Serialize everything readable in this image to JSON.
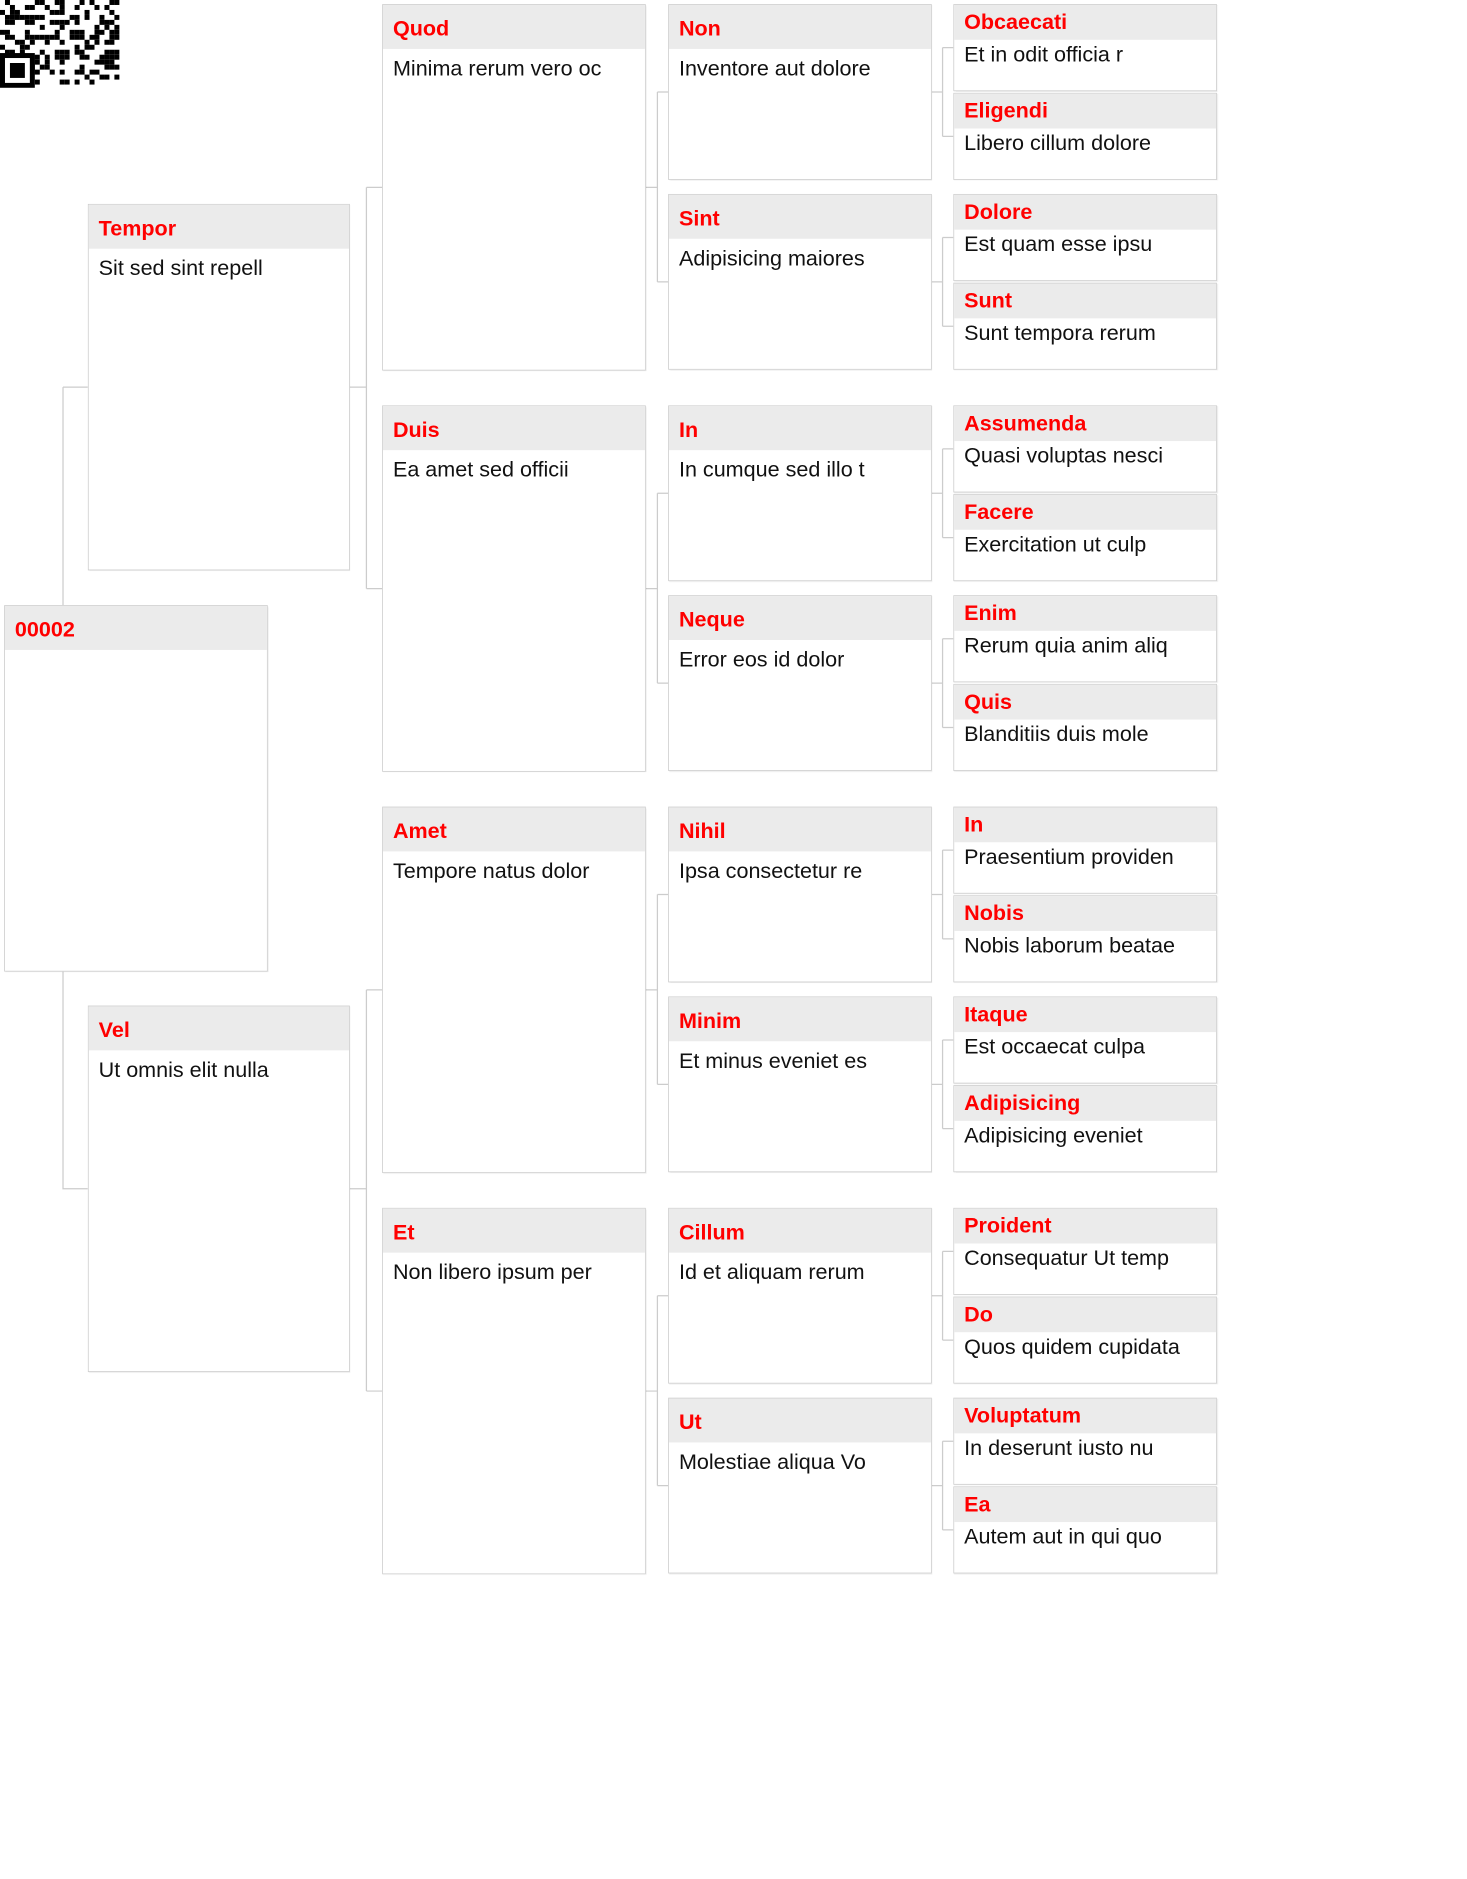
{
  "diagram": {
    "root": {
      "title": "00002",
      "body": ""
    },
    "level1": [
      {
        "title": "Tempor",
        "body": "Sit sed sint repell"
      },
      {
        "title": "Vel",
        "body": "Ut omnis elit nulla"
      }
    ],
    "level2": [
      {
        "title": "Quod",
        "body": "Minima rerum vero oc"
      },
      {
        "title": "Duis",
        "body": "Ea amet sed officii"
      },
      {
        "title": "Amet",
        "body": "Tempore natus dolor"
      },
      {
        "title": "Et",
        "body": "Non libero ipsum per"
      }
    ],
    "level3": [
      {
        "title": "Non",
        "body": "Inventore aut dolore"
      },
      {
        "title": "Sint",
        "body": "Adipisicing maiores"
      },
      {
        "title": "In",
        "body": "In cumque sed illo t"
      },
      {
        "title": "Neque",
        "body": "Error eos id dolor"
      },
      {
        "title": "Nihil",
        "body": "Ipsa consectetur re"
      },
      {
        "title": "Minim",
        "body": "Et minus eveniet es"
      },
      {
        "title": "Cillum",
        "body": "Id et aliquam rerum"
      },
      {
        "title": "Ut",
        "body": "Molestiae aliqua Vo"
      }
    ],
    "level4": [
      {
        "title": "Obcaecati",
        "body": "Et in odit officia r"
      },
      {
        "title": "Eligendi",
        "body": "Libero cillum dolore"
      },
      {
        "title": "Dolore",
        "body": "Est quam esse ipsu"
      },
      {
        "title": "Sunt",
        "body": "Sunt tempora rerum"
      },
      {
        "title": "Assumenda",
        "body": "Quasi voluptas nesci"
      },
      {
        "title": "Facere",
        "body": "Exercitation ut culp"
      },
      {
        "title": "Enim",
        "body": "Rerum quia anim aliq"
      },
      {
        "title": "Quis",
        "body": "Blanditiis duis mole"
      },
      {
        "title": "In",
        "body": "Praesentium providen"
      },
      {
        "title": "Nobis",
        "body": "Nobis laborum beatae"
      },
      {
        "title": "Itaque",
        "body": "Est occaecat culpa"
      },
      {
        "title": "Adipisicing",
        "body": "Adipisicing eveniet"
      },
      {
        "title": "Proident",
        "body": "Consequatur Ut temp"
      },
      {
        "title": "Do",
        "body": "Quos quidem cupidata"
      },
      {
        "title": "Voluptatum",
        "body": "In deserunt iusto nu"
      },
      {
        "title": "Ea",
        "body": "Autem aut in qui quo"
      }
    ]
  },
  "colors": {
    "title_text": "#ff0000",
    "title_band": "#ebebeb",
    "border": "#cfcfcf",
    "connector": "#cccccc"
  },
  "qr_code": {
    "icon": "qr-code-icon"
  }
}
